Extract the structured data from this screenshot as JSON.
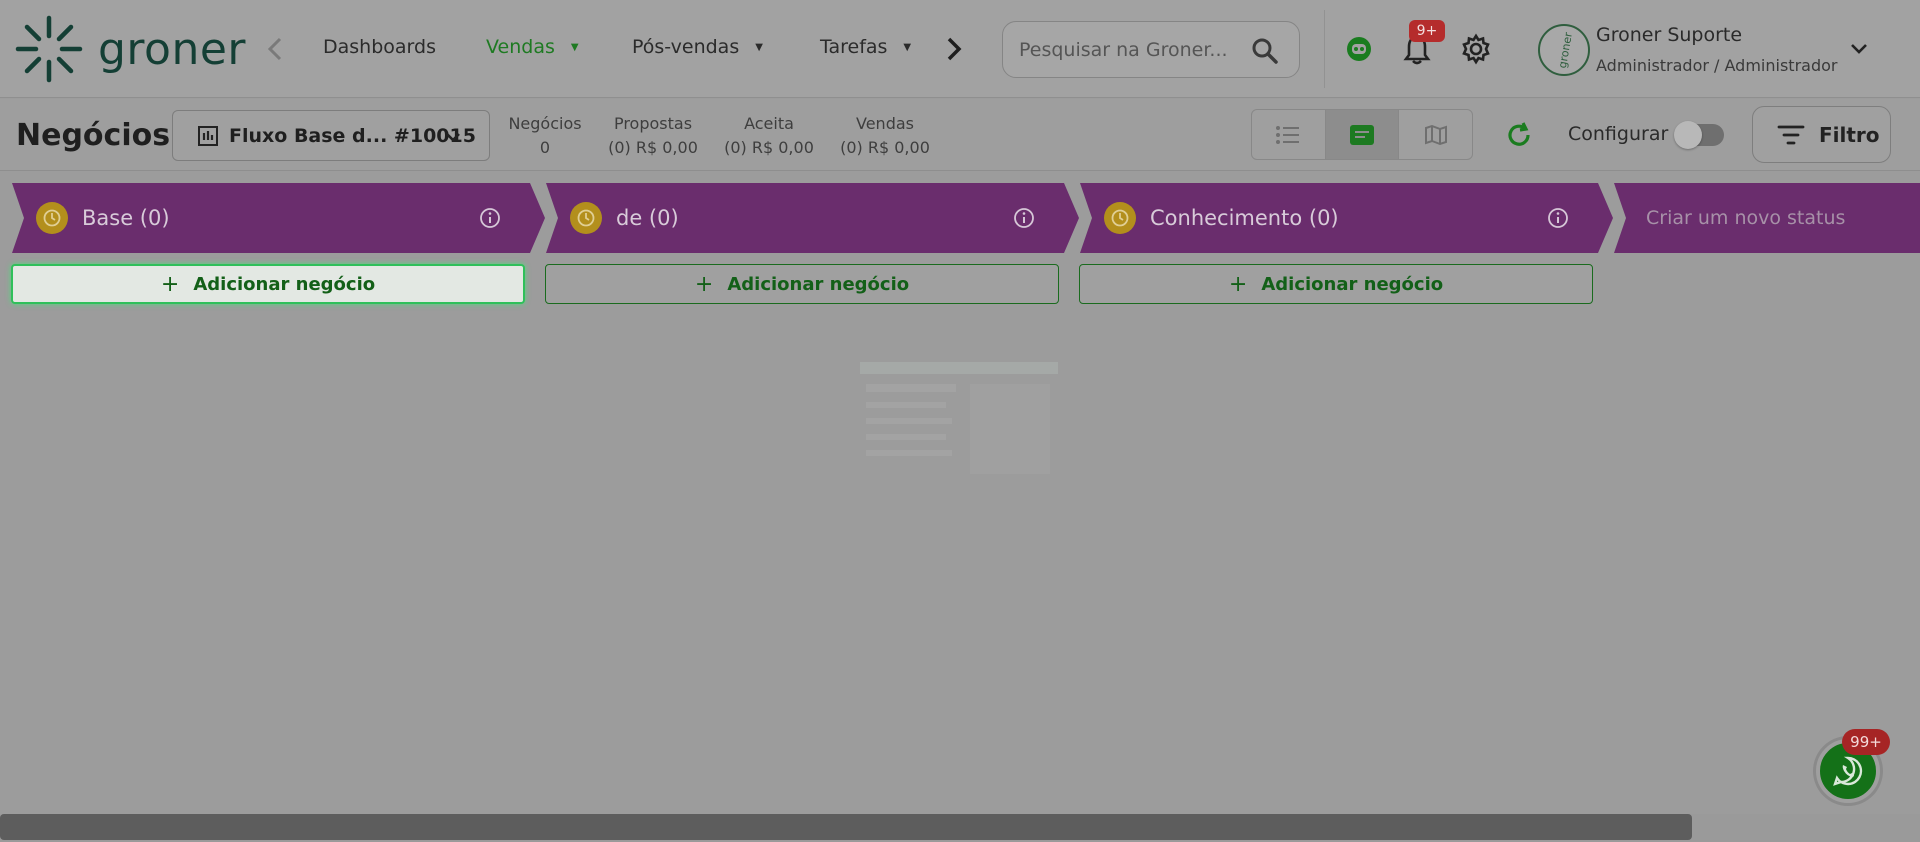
{
  "brand": {
    "name": "groner"
  },
  "nav": {
    "items": [
      {
        "label": "Dashboards",
        "active": false,
        "has_caret": false
      },
      {
        "label": "Vendas",
        "active": true,
        "has_caret": true
      },
      {
        "label": "Pós-vendas",
        "active": false,
        "has_caret": true
      },
      {
        "label": "Tarefas",
        "active": false,
        "has_caret": true
      }
    ]
  },
  "search": {
    "placeholder": "Pesquisar na Groner..."
  },
  "notifications": {
    "badge": "9+"
  },
  "user": {
    "name": "Groner Suporte",
    "role": "Administrador / Administrador",
    "avatar_text": "groner"
  },
  "page": {
    "title": "Negócios",
    "flow_select": "Fluxo Base d... #10015"
  },
  "stats": [
    {
      "label": "Negócios",
      "value": "0"
    },
    {
      "label": "Propostas",
      "value": "(0) R$ 0,00"
    },
    {
      "label": "Aceita",
      "value": "(0) R$ 0,00"
    },
    {
      "label": "Vendas",
      "value": "(0) R$ 0,00"
    }
  ],
  "toolbar": {
    "config_label": "Configurar",
    "filter_label": "Filtro"
  },
  "columns": [
    {
      "title": "Base (0)",
      "add_label": "Adicionar negócio"
    },
    {
      "title": "de (0)",
      "add_label": "Adicionar negócio"
    },
    {
      "title": "Conhecimento (0)",
      "add_label": "Adicionar negócio"
    }
  ],
  "new_status_label": "Criar um novo status",
  "whatsapp": {
    "badge": "99+"
  },
  "colors": {
    "accent_green": "#1e7a22",
    "column_purple": "#6a2d6d",
    "badge_red": "#b52c2c"
  }
}
